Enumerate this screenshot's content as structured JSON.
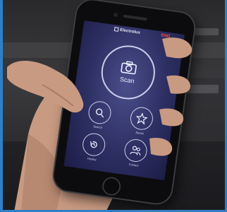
{
  "app": {
    "brand": "Electrolux",
    "lang_badge": "ENG"
  },
  "main_action": {
    "label": "Scan",
    "icon": "camera-icon"
  },
  "actions": [
    {
      "label": "Search",
      "icon": "search-icon"
    },
    {
      "label": "Saved",
      "icon": "star-icon"
    },
    {
      "label": "History",
      "icon": "history-icon"
    },
    {
      "label": "Contact",
      "icon": "contact-icon"
    }
  ],
  "colors": {
    "screen_bg": "#2d2f63",
    "accent_red": "#ff4a4a",
    "frame_border": "#2f7fc8"
  }
}
